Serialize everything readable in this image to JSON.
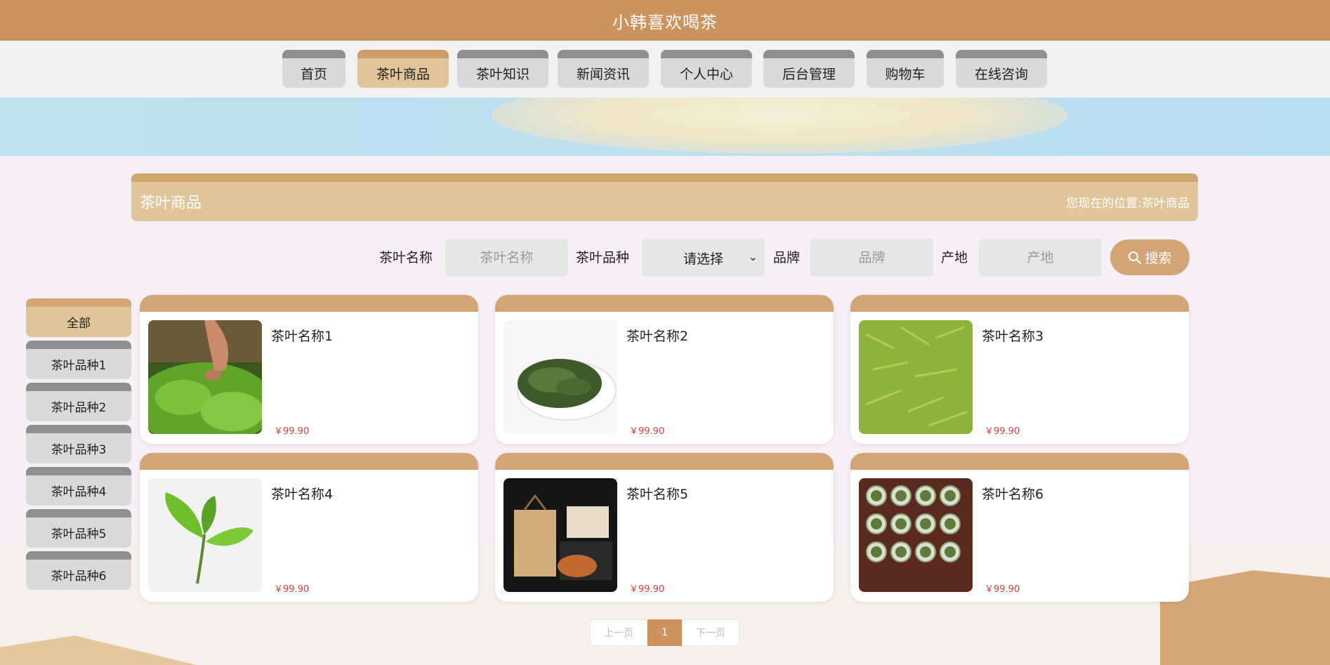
{
  "header": {
    "title": "小韩喜欢喝茶"
  },
  "nav": {
    "items": [
      {
        "label": "首页"
      },
      {
        "label": "茶叶商品"
      },
      {
        "label": "茶叶知识"
      },
      {
        "label": "新闻资讯"
      },
      {
        "label": "个人中心"
      },
      {
        "label": "后台管理"
      },
      {
        "label": "购物车"
      },
      {
        "label": "在线咨询"
      }
    ],
    "active": "茶叶商品"
  },
  "section": {
    "title": "茶叶商品",
    "breadcrumb_prefix": "您现在的位置:",
    "breadcrumb_current": "茶叶商品"
  },
  "search": {
    "name_label": "茶叶名称",
    "name_placeholder": "茶叶名称",
    "variety_label": "茶叶品种",
    "variety_selected": "请选择",
    "brand_label": "品牌",
    "brand_placeholder": "品牌",
    "origin_label": "产地",
    "origin_placeholder": "产地",
    "button_label": "搜索"
  },
  "categories": [
    {
      "label": "全部"
    },
    {
      "label": "茶叶品种1"
    },
    {
      "label": "茶叶品种2"
    },
    {
      "label": "茶叶品种3"
    },
    {
      "label": "茶叶品种4"
    },
    {
      "label": "茶叶品种5"
    },
    {
      "label": "茶叶品种6"
    }
  ],
  "products": [
    {
      "name": "茶叶名称1",
      "price": "￥99.90"
    },
    {
      "name": "茶叶名称2",
      "price": "￥99.90"
    },
    {
      "name": "茶叶名称3",
      "price": "￥99.90"
    },
    {
      "name": "茶叶名称4",
      "price": "￥99.90"
    },
    {
      "name": "茶叶名称5",
      "price": "￥99.90"
    },
    {
      "name": "茶叶名称6",
      "price": "￥99.90"
    }
  ],
  "pagination": {
    "prev": "上一页",
    "current": "1",
    "next": "下一页"
  },
  "colors": {
    "primary": "#cc935c",
    "accent_light": "#e0c49a",
    "price": "#e23a3a"
  }
}
